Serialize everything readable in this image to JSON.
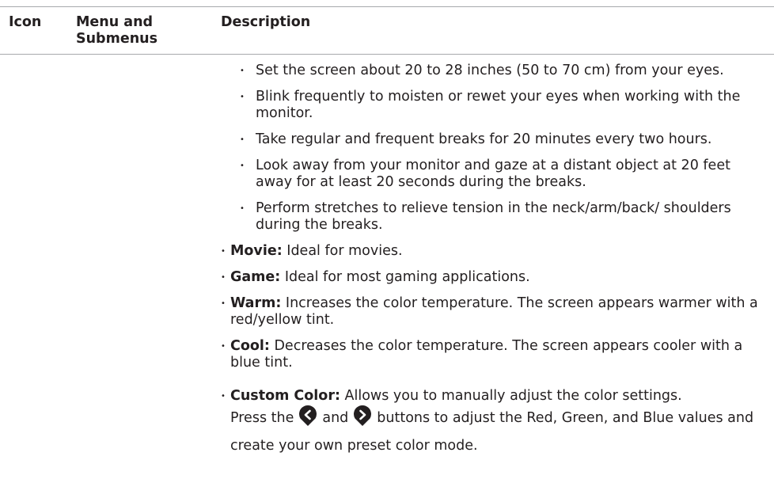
{
  "table": {
    "headers": {
      "icon": "Icon",
      "menu": "Menu and Submenus",
      "description": "Description"
    }
  },
  "tips": [
    "Set the screen about 20 to 28 inches (50 to 70 cm) from your eyes.",
    "Blink frequently to moisten or rewet your eyes when working with the monitor.",
    "Take regular and frequent breaks for 20 minutes every two hours.",
    "Look away from your monitor and gaze at a distant object at 20 feet away for at least 20 seconds during the breaks.",
    "Perform stretches to relieve tension in the neck/arm/back/ shoulders during the breaks."
  ],
  "modes": {
    "movie": {
      "label": "Movie:",
      "text": " Ideal for movies."
    },
    "game": {
      "label": "Game:",
      "text": " Ideal for most gaming applications."
    },
    "warm": {
      "label": "Warm:",
      "text": " Increases the color temperature. The screen appears warmer with a red/yellow tint."
    },
    "cool": {
      "label": "Cool:",
      "text": " Decreases the color temperature. The screen appears cooler with a blue tint."
    },
    "custom": {
      "label": "Custom Color:",
      "text": " Allows you to manually adjust the color settings.",
      "press_prefix": "Press the",
      "and": "and",
      "press_suffix": "buttons to adjust the Red, Green, and Blue values and create your own preset color mode."
    }
  },
  "bullet": "•",
  "icons": {
    "left_button": "chevron-left-button-icon",
    "right_button": "chevron-right-button-icon"
  },
  "colors": {
    "text": "#231f20",
    "rule": "#a7a9ac",
    "button": "#231f20"
  }
}
